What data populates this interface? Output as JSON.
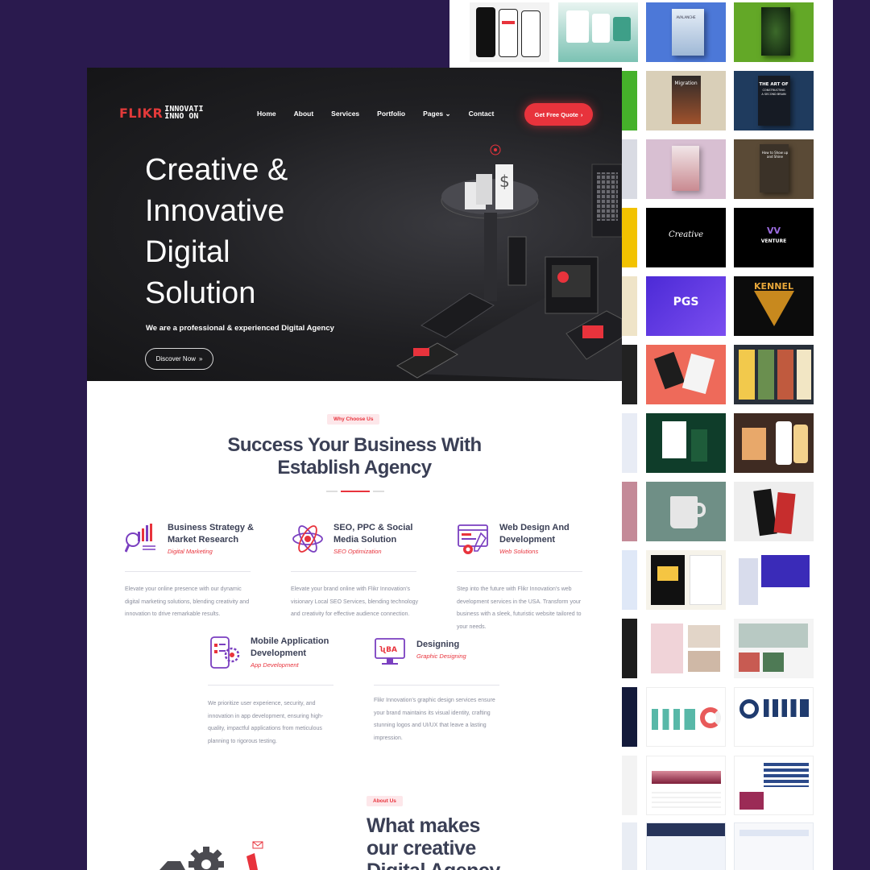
{
  "hero": {
    "logo_main": "FLIKR",
    "logo_top": "INNOVATI",
    "logo_bottom": "INNO  ON",
    "nav": [
      "Home",
      "About",
      "Services",
      "Portfolio",
      "Pages",
      "Contact"
    ],
    "quote_button": "Get Free Quote",
    "title_lines": [
      "Creative &",
      "Innovative",
      "Digital",
      "Solution"
    ],
    "subtitle": "We are a professional & experienced Digital Agency",
    "discover_button": "Discover Now"
  },
  "why": {
    "badge": "Why Choose Us",
    "title_line1": "Success Your Business With",
    "title_line2": "Establish Agency"
  },
  "services": [
    {
      "title": "Business Strategy & Market Research",
      "subtitle": "Digital Marketing",
      "icon": "chart-search-icon",
      "description": "Elevate your online presence with our dynamic digital marketing solutions, blending creativity and innovation to drive remarkable results."
    },
    {
      "title": "SEO, PPC & Social Media Solution",
      "subtitle": "SEO Optimization",
      "icon": "atom-icon",
      "description": "Elevate your brand online with Flikr Innovation's visionary Local SEO Services, blending technology and creativity for effective audience connection."
    },
    {
      "title": "Web Design And Development",
      "subtitle": "Web Solutions",
      "icon": "browser-gear-icon",
      "description": "Step into the future with Flikr Innovation's web development services in the USA. Transform your business with a sleek, futuristic website tailored to your needs."
    },
    {
      "title": "Mobile Application Development",
      "subtitle": "App Development",
      "icon": "mobile-gear-icon",
      "description": "We prioritize user experience, security, and innovation in app development, ensuring high-quality, impactful applications from meticulous planning to rigorous testing."
    },
    {
      "title": "Designing",
      "subtitle": "Graphic Designing",
      "icon": "monitor-design-icon",
      "description": "Flikr Innovation's graphic design services ensure your brand maintains its visual identity, crafting stunning logos and UI/UX that leave a lasting impression."
    }
  ],
  "about": {
    "badge": "About Us",
    "title_lines": [
      "What makes",
      "our creative",
      "Digital Agency"
    ]
  },
  "portfolio": {
    "book1": "AVALANCHE",
    "book2_l1": "THE ART OF",
    "book2_l2": "CONSTRUCTING",
    "book2_l3": "A SECOND BRAIN",
    "book3": "Migration",
    "book4": "How to Show up and Shine",
    "logo_creative": "Creative",
    "logo_venture": "VENTURE",
    "logo_pgs": "PGS",
    "logo_kennel": "KENNEL"
  },
  "colors": {
    "accent": "#e8333c",
    "background": "#2a1a4e",
    "heading": "#3a3f55",
    "icon_purple": "#7a3fc0"
  }
}
